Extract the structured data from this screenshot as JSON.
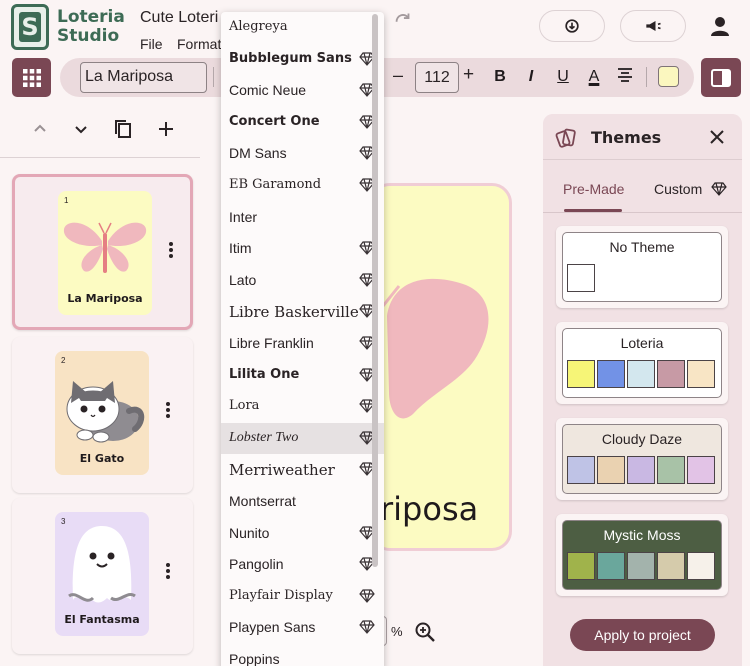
{
  "app": {
    "logo_letter": "S",
    "logo_line1": "Loteria",
    "logo_line2": "Studio",
    "doc_title": "Cute Loteri",
    "menu_file": "File",
    "menu_format": "Format"
  },
  "toolbar": {
    "text_value": "La Mariposa",
    "minus": "–",
    "font_size": "112",
    "plus": "+",
    "bold": "B",
    "italic": "I",
    "underline": "U",
    "text_color": "A",
    "highlight_color": "#fbf7bf"
  },
  "cards": [
    {
      "num": "1",
      "label": "La Mariposa",
      "bg": "#fcfbc2"
    },
    {
      "num": "2",
      "label": "El Gato",
      "bg": "#f8e3c4"
    },
    {
      "num": "3",
      "label": "El Fantasma",
      "bg": "#e8dcf6"
    }
  ],
  "canvas": {
    "visible_text": "riposa",
    "zoom_unit": "%"
  },
  "font_menu": {
    "items": [
      {
        "name": "Alegreya",
        "premium": false,
        "font": "serif",
        "highlight": false
      },
      {
        "name": "Bubblegum Sans",
        "premium": true,
        "font": "sans-bold",
        "highlight": false
      },
      {
        "name": "Comic Neue",
        "premium": true,
        "font": "sans",
        "highlight": false
      },
      {
        "name": "Concert One",
        "premium": true,
        "font": "sans-bold",
        "highlight": false
      },
      {
        "name": "DM Sans",
        "premium": true,
        "font": "sans",
        "highlight": false
      },
      {
        "name": "EB Garamond",
        "premium": true,
        "font": "serif",
        "highlight": false
      },
      {
        "name": "Inter",
        "premium": false,
        "font": "sans",
        "highlight": false
      },
      {
        "name": "Itim",
        "premium": true,
        "font": "sans",
        "highlight": false
      },
      {
        "name": "Lato",
        "premium": true,
        "font": "sans",
        "highlight": false
      },
      {
        "name": "Libre Baskerville",
        "premium": true,
        "font": "serif-large",
        "highlight": false
      },
      {
        "name": "Libre Franklin",
        "premium": true,
        "font": "sans",
        "highlight": false
      },
      {
        "name": "Lilita One",
        "premium": true,
        "font": "sans-bold",
        "highlight": false
      },
      {
        "name": "Lora",
        "premium": true,
        "font": "serif",
        "highlight": false
      },
      {
        "name": "Lobster Two",
        "premium": true,
        "font": "serif-italic",
        "highlight": true
      },
      {
        "name": "Merriweather",
        "premium": true,
        "font": "serif-large",
        "highlight": false
      },
      {
        "name": "Montserrat",
        "premium": false,
        "font": "sans",
        "highlight": false
      },
      {
        "name": "Nunito",
        "premium": true,
        "font": "sans",
        "highlight": false
      },
      {
        "name": "Pangolin",
        "premium": true,
        "font": "sans",
        "highlight": false
      },
      {
        "name": "Playfair Display",
        "premium": true,
        "font": "serif",
        "highlight": false
      },
      {
        "name": "Playpen Sans",
        "premium": true,
        "font": "sans",
        "highlight": false
      },
      {
        "name": "Poppins",
        "premium": false,
        "font": "sans",
        "highlight": false
      }
    ]
  },
  "themes": {
    "title": "Themes",
    "tab_premade": "Pre-Made",
    "tab_custom": "Custom",
    "apply_label": "Apply to project",
    "items": [
      {
        "name": "No Theme",
        "bg": "#ffffff",
        "text": "#2a2325",
        "colors": [
          "#ffffff"
        ]
      },
      {
        "name": "Loteria",
        "bg": "#ffffff",
        "text": "#2a2325",
        "colors": [
          "#f6f577",
          "#7292e6",
          "#d3e7ee",
          "#c79aa5",
          "#f8e5c5"
        ]
      },
      {
        "name": "Cloudy Daze",
        "bg": "#efe7df",
        "text": "#2a2325",
        "colors": [
          "#bfc3e6",
          "#ead2b1",
          "#c9b8e3",
          "#a8c2a7",
          "#e2c3e6"
        ]
      },
      {
        "name": "Mystic Moss",
        "bg": "#4d5e43",
        "text": "#ffffff",
        "colors": [
          "#a0b34b",
          "#6aa79c",
          "#a3b3ac",
          "#d5cbab",
          "#f6f1ea"
        ]
      }
    ]
  },
  "colors": {
    "accent": "#7a4754",
    "brand_green": "#3d6b55",
    "selected_card_border": "#e3a7b6"
  }
}
